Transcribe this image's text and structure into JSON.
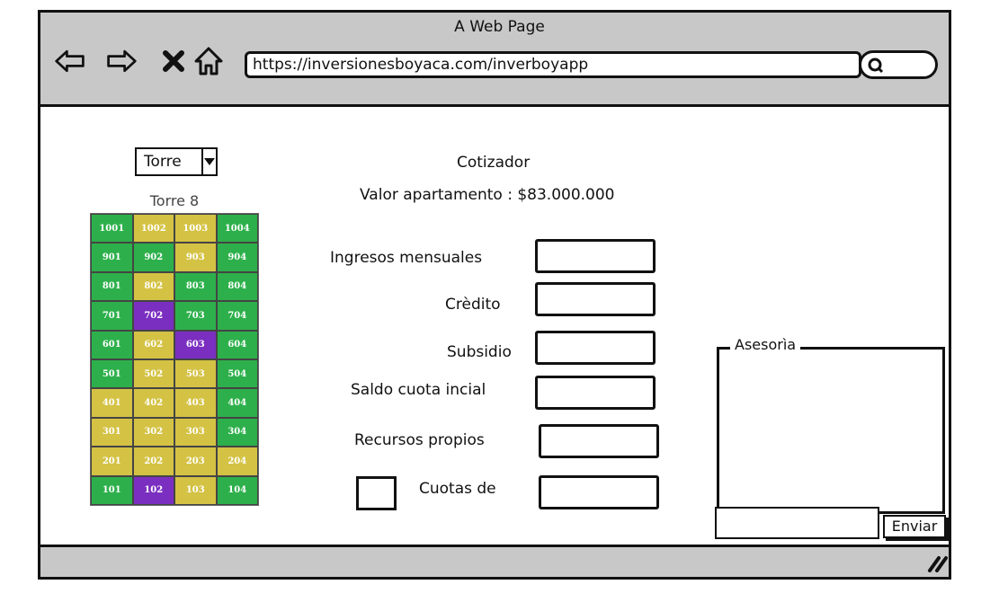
{
  "window": {
    "title": "A Web Page"
  },
  "browser": {
    "url": "https://inversionesboyaca.com/inverboyapp",
    "icons": [
      "back-arrow-icon",
      "forward-arrow-icon",
      "close-x-icon",
      "home-icon",
      "search-icon",
      "resize-grip-icon"
    ]
  },
  "tower": {
    "select_value": "Torre",
    "name": "Torre 8",
    "legend_colors": {
      "green": "#2db04b",
      "yellow": "#d4c244",
      "purple": "#7b2fc0"
    },
    "rows": [
      [
        {
          "n": "1001",
          "c": "green"
        },
        {
          "n": "1002",
          "c": "yellow"
        },
        {
          "n": "1003",
          "c": "yellow"
        },
        {
          "n": "1004",
          "c": "green"
        }
      ],
      [
        {
          "n": "901",
          "c": "green"
        },
        {
          "n": "902",
          "c": "green"
        },
        {
          "n": "903",
          "c": "yellow"
        },
        {
          "n": "904",
          "c": "green"
        }
      ],
      [
        {
          "n": "801",
          "c": "green"
        },
        {
          "n": "802",
          "c": "yellow"
        },
        {
          "n": "803",
          "c": "green"
        },
        {
          "n": "804",
          "c": "green"
        }
      ],
      [
        {
          "n": "701",
          "c": "green"
        },
        {
          "n": "702",
          "c": "purple"
        },
        {
          "n": "703",
          "c": "green"
        },
        {
          "n": "704",
          "c": "green"
        }
      ],
      [
        {
          "n": "601",
          "c": "green"
        },
        {
          "n": "602",
          "c": "yellow"
        },
        {
          "n": "603",
          "c": "purple"
        },
        {
          "n": "604",
          "c": "green"
        }
      ],
      [
        {
          "n": "501",
          "c": "green"
        },
        {
          "n": "502",
          "c": "yellow"
        },
        {
          "n": "503",
          "c": "yellow"
        },
        {
          "n": "504",
          "c": "green"
        }
      ],
      [
        {
          "n": "401",
          "c": "yellow"
        },
        {
          "n": "402",
          "c": "yellow"
        },
        {
          "n": "403",
          "c": "yellow"
        },
        {
          "n": "404",
          "c": "green"
        }
      ],
      [
        {
          "n": "301",
          "c": "yellow"
        },
        {
          "n": "302",
          "c": "yellow"
        },
        {
          "n": "303",
          "c": "yellow"
        },
        {
          "n": "304",
          "c": "green"
        }
      ],
      [
        {
          "n": "201",
          "c": "yellow"
        },
        {
          "n": "202",
          "c": "yellow"
        },
        {
          "n": "203",
          "c": "yellow"
        },
        {
          "n": "204",
          "c": "yellow"
        }
      ],
      [
        {
          "n": "101",
          "c": "green"
        },
        {
          "n": "102",
          "c": "purple"
        },
        {
          "n": "103",
          "c": "yellow"
        },
        {
          "n": "104",
          "c": "green"
        }
      ]
    ]
  },
  "quote": {
    "title": "Cotizador",
    "price_text": "Valor apartamento : $83.000.000",
    "labels": {
      "income": "Ingresos mensuales",
      "credit": "Crèdito",
      "subsidy": "Subsidio",
      "down_payment": "Saldo cuota incial",
      "own_resources": "Recursos propios",
      "installments": "Cuotas de"
    }
  },
  "advice": {
    "legend": "Asesorìa",
    "send_label": "Enviar"
  }
}
